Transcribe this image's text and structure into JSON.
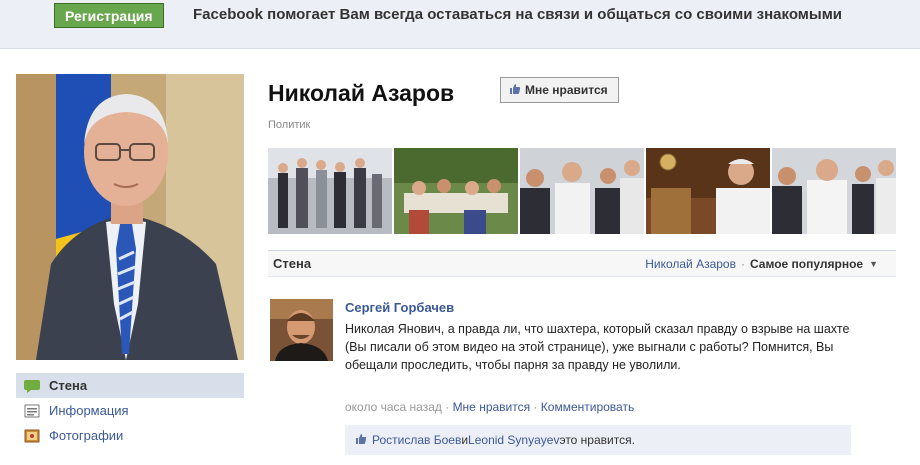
{
  "topbar": {
    "register_label": "Регистрация",
    "message": "Facebook помогает Вам всегда оставаться на связи и общаться со своими знакомыми"
  },
  "sidebar": {
    "items": [
      {
        "label": "Стена",
        "icon": "wall-icon",
        "active": true
      },
      {
        "label": "Информация",
        "icon": "info-icon",
        "active": false
      },
      {
        "label": "Фотографии",
        "icon": "photos-icon",
        "active": false
      }
    ]
  },
  "page": {
    "name": "Николай Азаров",
    "like_label": "Мне нравится",
    "category": "Политик"
  },
  "wall": {
    "tab_label": "Стена",
    "filter_name": "Николай Азаров",
    "separator": "·",
    "sort_label": "Самое популярное"
  },
  "post": {
    "author": "Сергей Горбачев",
    "text": "Николая Янович, а правда ли, что шахтера, который сказал правду о взрыве на шахте (Вы писали об этом видео на этой странице), уже выгнали с работы? Помнится, Вы обещали проследить, чтобы парня за правду не уволили.",
    "time": "около часа назад",
    "sep1": " · ",
    "like_link": "Мне нравится",
    "sep2": " · ",
    "comment_link": "Комментировать",
    "likes": {
      "user1": "Ростислав Боев",
      "and": " и ",
      "user2": "Leonid Synyayev",
      "suffix": " это нравится."
    }
  },
  "colors": {
    "link": "#3b5998",
    "register_green": "#69a74e",
    "topbar_bg": "#eceff5",
    "active_nav_bg": "#d8dfea"
  }
}
